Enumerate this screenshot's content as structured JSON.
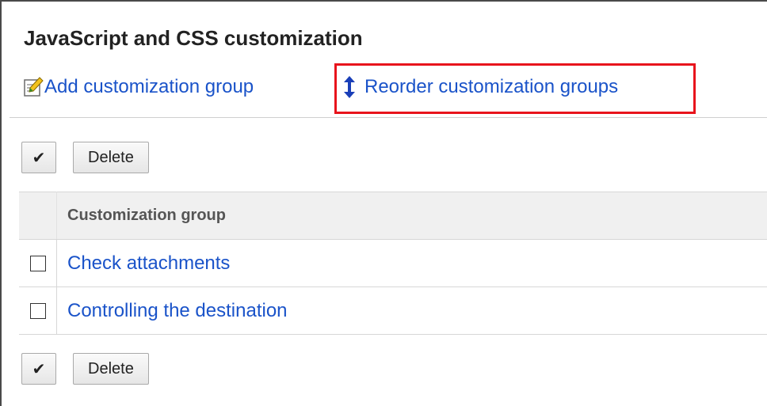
{
  "page": {
    "title": "JavaScript and CSS customization"
  },
  "actions": {
    "add_label": "Add customization group",
    "reorder_label": "Reorder customization groups"
  },
  "toolbar": {
    "check_all_symbol": "✔",
    "delete_label": "Delete"
  },
  "table": {
    "header": "Customization group",
    "rows": [
      {
        "name": "Check attachments"
      },
      {
        "name": "Controlling the destination"
      }
    ]
  },
  "colors": {
    "link": "#1a53c9",
    "highlight_box": "#e8141c",
    "header_bg": "#f0f0f0"
  },
  "icons": {
    "add": "edit-note-icon",
    "reorder": "reorder-arrows-icon"
  }
}
